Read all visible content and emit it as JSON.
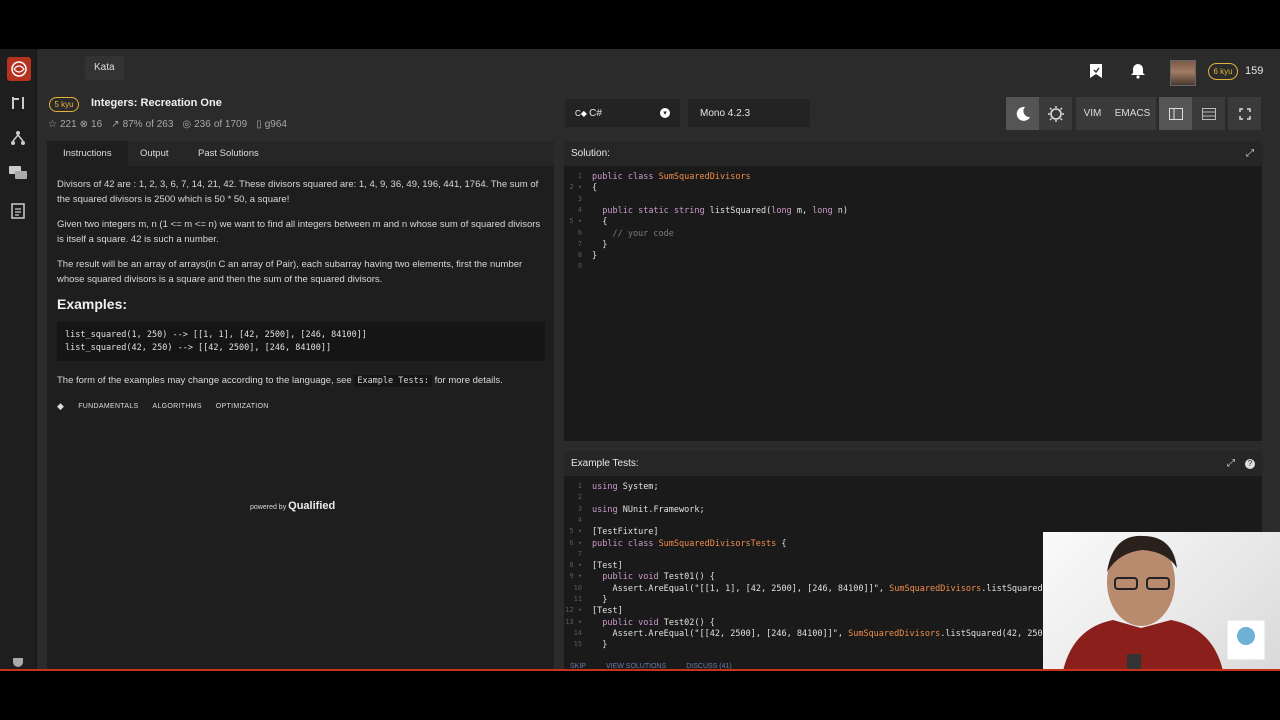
{
  "topbar": {
    "kata_tab": "Kata",
    "kyu": "6 kyu",
    "honor": "159"
  },
  "kata": {
    "kyu": "5 kyu",
    "title": "Integers: Recreation One",
    "stats": {
      "stars": "221",
      "followers": "16",
      "satisfaction": "87%",
      "sat_of": "of 263",
      "completed": "236",
      "completed_of": "of 1709",
      "author": "g964"
    }
  },
  "language": {
    "selected": "C#",
    "version": "Mono 4.2.3"
  },
  "toolbar": {
    "vim": "VIM",
    "emacs": "EMACS"
  },
  "tabs": [
    "Instructions",
    "Output",
    "Past Solutions"
  ],
  "instructions": {
    "p1": "Divisors of 42 are : 1, 2, 3, 6, 7, 14, 21, 42. These divisors squared are: 1, 4, 9, 36, 49, 196, 441, 1764. The sum of the squared divisors is 2500 which is 50 * 50, a square!",
    "p2": "Given two integers m, n (1 <= m <= n) we want to find all integers between m and n whose sum of squared divisors is itself a square. 42 is such a number.",
    "p3": "The result will be an array of arrays(in C an array of Pair), each subarray having two elements, first the number whose squared divisors is a square and then the sum of the squared divisors.",
    "examples_heading": "Examples:",
    "example_code": "list_squared(1, 250) --> [[1, 1], [42, 2500], [246, 84100]]\nlist_squared(42, 250) --> [[42, 2500], [246, 84100]]",
    "p4_pre": "The form of the examples may change according to the language, see",
    "p4_code": "Example Tests:",
    "p4_post": "for more details.",
    "tags": [
      "FUNDAMENTALS",
      "ALGORITHMS",
      "OPTIMIZATION"
    ],
    "powered_by": "powered by",
    "qualified": "Qualified"
  },
  "solution": {
    "title": "Solution:",
    "lines": [
      "public class SumSquaredDivisors",
      "{",
      "",
      "  public static string listSquared(long m, long n)",
      "  {",
      "    // your code",
      "  }",
      "}",
      ""
    ]
  },
  "tests": {
    "title": "Example Tests:",
    "lines": [
      "using System;",
      "",
      "using NUnit.Framework;",
      "",
      "[TestFixture]",
      "public class SumSquaredDivisorsTests {",
      "",
      "[Test]",
      "  public void Test01() {",
      "    Assert.AreEqual(\"[[1, 1], [42, 2500], [246, 84100]]\", SumSquaredDivisors.listSquared",
      "  }",
      "[Test]",
      "  public void Test02() {",
      "    Assert.AreEqual(\"[[42, 2500], [246, 84100]]\", SumSquaredDivisors.listSquared(42, 250",
      "  }"
    ]
  },
  "bottom_links": [
    "SKIP",
    "VIEW SOLUTIONS",
    "DISCUSS (41)"
  ],
  "colors": {
    "accent": "#b5321f",
    "kyu_yellow": "#e5b23a",
    "keyword": "#cc99cd",
    "class_name": "#f08d49"
  }
}
